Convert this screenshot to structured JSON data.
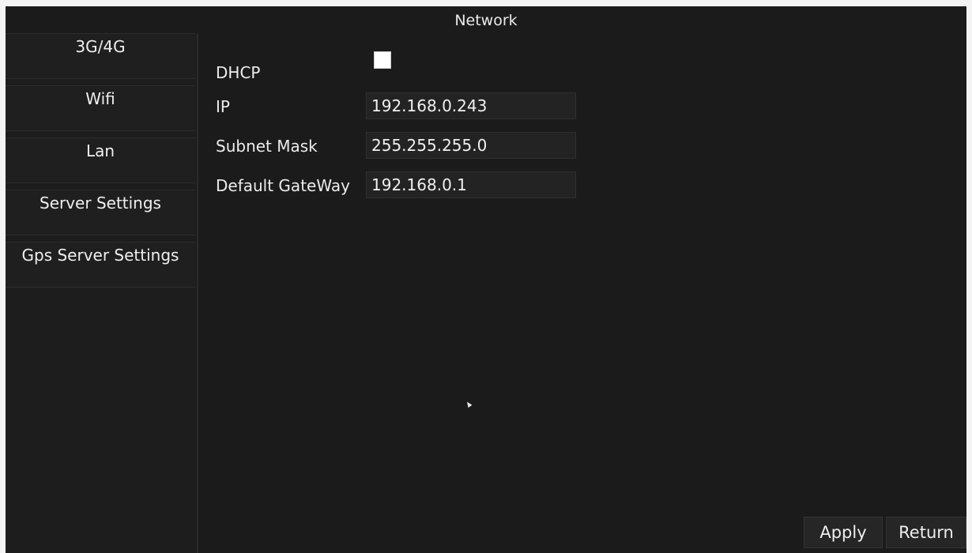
{
  "window": {
    "title": "Network"
  },
  "sidebar": {
    "items": [
      {
        "label": "3G/4G"
      },
      {
        "label": "Wifi"
      },
      {
        "label": "Lan"
      },
      {
        "label": "Server Settings"
      },
      {
        "label": "Gps Server Settings"
      }
    ]
  },
  "form": {
    "dhcp": {
      "label": "DHCP",
      "checked": false
    },
    "ip": {
      "label": "IP",
      "value": "192.168.0.243"
    },
    "subnet": {
      "label": "Subnet Mask",
      "value": "255.255.255.0"
    },
    "gateway": {
      "label": "Default GateWay",
      "value": "192.168.0.1"
    }
  },
  "buttons": {
    "apply": "Apply",
    "return": "Return"
  },
  "icons": {
    "cursor": "mouse-pointer-icon"
  },
  "colors": {
    "background": "#1b1b1b",
    "text": "#e9e9e9"
  }
}
